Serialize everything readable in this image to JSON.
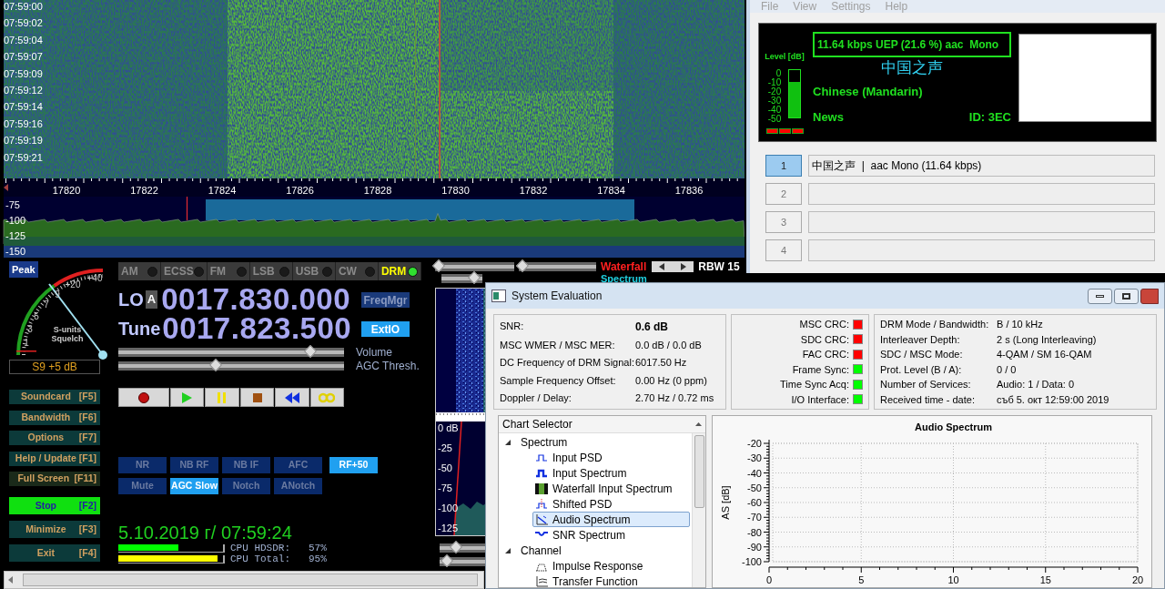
{
  "hdsdr": {
    "waterfall": {
      "times": [
        "07:59:00",
        "07:59:02",
        "07:59:04",
        "07:59:07",
        "07:59:09",
        "07:59:12",
        "07:59:14",
        "07:59:16",
        "07:59:19",
        "07:59:21"
      ],
      "freq_ticks": [
        "17820",
        "17822",
        "17824",
        "17826",
        "17828",
        "17830",
        "17832",
        "17834",
        "17836"
      ]
    },
    "spectrum": {
      "db_ticks": [
        "-75",
        "-100",
        "-125",
        "-150"
      ]
    },
    "peak_button": "Peak",
    "smeter": {
      "scale": [
        "+40",
        "+20",
        "9",
        "7",
        "5",
        "3",
        "1"
      ],
      "units_label": "S-units",
      "squelch_label": "Squelch",
      "reading": "S9 +5 dB"
    },
    "modes": [
      {
        "label": "AM",
        "selected": false
      },
      {
        "label": "ECSS",
        "selected": false
      },
      {
        "label": "FM",
        "selected": false
      },
      {
        "label": "LSB",
        "selected": false
      },
      {
        "label": "USB",
        "selected": false
      },
      {
        "label": "CW",
        "selected": false
      },
      {
        "label": "DRM",
        "selected": true
      }
    ],
    "lo": {
      "label": "LO",
      "bank": "A",
      "value": "0017.830.000"
    },
    "tune": {
      "label": "Tune",
      "value": "0017.823.500"
    },
    "freqmgr": {
      "label": "FreqMgr",
      "on": false
    },
    "extio": {
      "label": "ExtIO",
      "on": true
    },
    "sliders": [
      {
        "name": "Volume",
        "level": 0.85
      },
      {
        "name": "AGC Thresh.",
        "level": 0.43
      }
    ],
    "function_keys": [
      [
        {
          "label": "Soundcard",
          "key": "[F5]",
          "kind": "normal"
        },
        {
          "label": "Bandwidth",
          "key": "[F6]",
          "kind": "normal"
        },
        {
          "label": "Options",
          "key": "[F7]",
          "kind": "normal"
        },
        {
          "label": "Help / Update",
          "key": "[F1]",
          "kind": "normal"
        },
        {
          "label": "Full Screen",
          "key": "[F11]",
          "kind": "dim"
        }
      ],
      [
        {
          "label": "Stop",
          "key": "[F2]",
          "kind": "active"
        },
        {
          "label": "Minimize",
          "key": "[F3]",
          "kind": "normal"
        },
        {
          "label": "Exit",
          "key": "[F4]",
          "kind": "normal"
        }
      ]
    ],
    "dsp_buttons": [
      [
        {
          "label": "NR",
          "on": false
        },
        {
          "label": "NB RF",
          "on": false
        },
        {
          "label": "NB IF",
          "on": false
        },
        {
          "label": "AFC",
          "on": false
        },
        {
          "label": "RF+50",
          "on": true
        }
      ],
      [
        {
          "label": "Mute",
          "on": false
        },
        {
          "label": "AGC Slow",
          "on": true
        },
        {
          "label": "Notch",
          "on": false
        },
        {
          "label": "ANotch",
          "on": false
        }
      ]
    ],
    "datetime": "5.10.2019 г/ 07:59:24",
    "cpu": [
      {
        "label": "CPU HDSDR:",
        "reading": "57%",
        "level": 0.57,
        "color": "#00ff00"
      },
      {
        "label": "CPU Total:",
        "reading": "95%",
        "level": 0.95,
        "color": "#ffff00"
      }
    ],
    "side_panel": {
      "waterfall_label": "Waterfall",
      "spectrum_label": "Spectrum",
      "rbw": "RBW 15",
      "sliders": [
        {
          "level": 0.05
        },
        {
          "level": 0.05
        },
        {
          "level": 0.8
        },
        {
          "level": 0.35
        },
        {
          "level": 0.15
        }
      ],
      "db_ticks": [
        "0 dB",
        "-25",
        "-50",
        "-75",
        "-100",
        "-125"
      ]
    }
  },
  "drm": {
    "menu": [
      "File",
      "View",
      "Settings",
      "Help"
    ],
    "display": {
      "level_label": "Level [dB]",
      "level_ticks": [
        "0",
        "-10",
        "-20",
        "-30",
        "-40",
        "-50"
      ],
      "level": 0.75,
      "indicators": [
        {
          "color": "#ff0000"
        },
        {
          "color": "#ff0000"
        },
        {
          "color": "#ff0000"
        }
      ],
      "bitrate": "11.64 kbps UEP (21.6 %) aac  Mono",
      "label": "中国之声",
      "language": "Chinese (Mandarin)",
      "programme": "News",
      "id": "ID: 3EC"
    },
    "services": [
      {
        "number": "1",
        "selected": true,
        "text": "中国之声  |  aac Mono (11.64 kbps)"
      },
      {
        "number": "2",
        "selected": false
      },
      {
        "number": "3",
        "selected": false
      },
      {
        "number": "4",
        "selected": false
      }
    ]
  },
  "system_evaluation": {
    "title": "System Evaluation",
    "measurements": [
      {
        "label": "SNR:",
        "value": "0.6 dB"
      },
      {
        "label": "MSC WMER / MSC MER:",
        "value": "0.0 dB / 0.0 dB"
      },
      {
        "label": "DC Frequency of DRM Signal:",
        "value": "6017.50 Hz"
      },
      {
        "label": "Sample Frequency Offset:",
        "value": "0.00 Hz (0 ppm)"
      },
      {
        "label": "Doppler / Delay:",
        "value": "2.70 Hz / 0.72 ms"
      }
    ],
    "status": [
      {
        "label": "MSC CRC:",
        "color": "#ff0000"
      },
      {
        "label": "SDC CRC:",
        "color": "#ff0000"
      },
      {
        "label": "FAC CRC:",
        "color": "#ff0000"
      },
      {
        "label": "Frame Sync:",
        "color": "#00ff00"
      },
      {
        "label": "Time Sync Acq:",
        "color": "#00ff00"
      },
      {
        "label": "I/O Interface:",
        "color": "#00ff00"
      }
    ],
    "info": [
      {
        "label": "DRM Mode / Bandwidth:",
        "value": "B / 10 kHz"
      },
      {
        "label": "Interleaver Depth:",
        "value": "2 s (Long Interleaving)"
      },
      {
        "label": "SDC / MSC Mode:",
        "value": "4-QAM / SM 16-QAM"
      },
      {
        "label": "Prot. Level (B / A):",
        "value": "0 / 0"
      },
      {
        "label": "Number of Services:",
        "value": "Audio: 1 / Data: 0"
      },
      {
        "label": "Received time - date:",
        "value": "съб 5. окт 12:59:00 2019"
      }
    ],
    "chart_selector": {
      "title": "Chart Selector",
      "tree": [
        {
          "label": "Spectrum",
          "expanded": true,
          "children": [
            {
              "label": "Input PSD",
              "kind": "psd",
              "selected": false
            },
            {
              "label": "Input Spectrum",
              "kind": "spectrum",
              "selected": false
            },
            {
              "label": "Waterfall Input Spectrum",
              "kind": "waterfall",
              "selected": false
            },
            {
              "label": "Shifted PSD",
              "kind": "shifted",
              "selected": false
            },
            {
              "label": "Audio Spectrum",
              "kind": "audio",
              "selected": true
            },
            {
              "label": "SNR Spectrum",
              "kind": "snr",
              "selected": false
            }
          ]
        },
        {
          "label": "Channel",
          "expanded": true,
          "children": [
            {
              "label": "Impulse Response",
              "kind": "impulse",
              "selected": false
            },
            {
              "label": "Transfer Function",
              "kind": "transfer",
              "selected": false
            }
          ]
        }
      ]
    },
    "chart_data": {
      "type": "line",
      "grid": true,
      "title": "Audio Spectrum",
      "ylabel": "AS [dB]",
      "xlim": [
        0,
        20
      ],
      "ylim": [
        -100,
        -20
      ],
      "xticks": [
        0,
        5,
        10,
        15,
        20
      ],
      "yticks": [
        -20,
        -30,
        -40,
        -50,
        -60,
        -70,
        -80,
        -90,
        -100
      ]
    }
  }
}
